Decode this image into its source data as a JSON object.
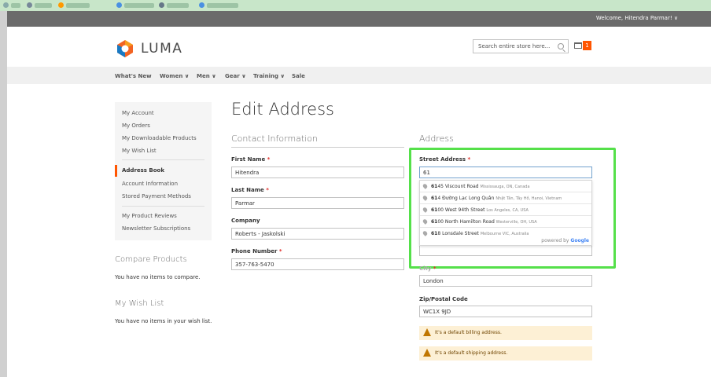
{
  "header": {
    "welcome": "Welcome, Hitendra Parmar! ∨",
    "logo_text": "LUMA",
    "search_placeholder": "Search entire store here...",
    "cart_count": "1"
  },
  "nav": [
    {
      "label": "What's New"
    },
    {
      "label": "Women ∨"
    },
    {
      "label": "Men ∨"
    },
    {
      "label": "Gear ∨"
    },
    {
      "label": "Training ∨"
    },
    {
      "label": "Sale"
    }
  ],
  "sidebar": {
    "items": [
      {
        "label": "My Account"
      },
      {
        "label": "My Orders"
      },
      {
        "label": "My Downloadable Products"
      },
      {
        "label": "My Wish List"
      },
      {
        "label": "Address Book"
      },
      {
        "label": "Account Information"
      },
      {
        "label": "Stored Payment Methods"
      },
      {
        "label": "My Product Reviews"
      },
      {
        "label": "Newsletter Subscriptions"
      }
    ],
    "compare_title": "Compare Products",
    "compare_text": "You have no items to compare.",
    "wishlist_title": "My Wish List",
    "wishlist_text": "You have no items in your wish list."
  },
  "page": {
    "title": "Edit Address",
    "contact_title": "Contact Information",
    "address_title": "Address"
  },
  "form": {
    "first_name_label": "First Name",
    "first_name_value": "Hitendra",
    "last_name_label": "Last Name",
    "last_name_value": "Parmar",
    "company_label": "Company",
    "company_value": "Roberts - Jaskolski",
    "phone_label": "Phone Number",
    "phone_value": "357-763-5470",
    "street_label": "Street Address",
    "street_value": "61",
    "city_label": "City",
    "city_value": "London",
    "zip_label": "Zip/Postal Code",
    "zip_value": "WC1X 9JD",
    "required_mark": "*"
  },
  "autocomplete": {
    "items": [
      {
        "main_bold": "61",
        "main_rest": "45 Viscount Road",
        "sub": "Mississauga, ON, Canada"
      },
      {
        "main_bold": "61",
        "main_rest": "4 Đường Lạc Long Quân",
        "sub": "Nhật Tân, Tây Hồ, Hanoi, Vietnam"
      },
      {
        "main_bold": "61",
        "main_rest": "00 West 94th Street",
        "sub": "Los Angeles, CA, USA"
      },
      {
        "main_bold": "61",
        "main_rest": "00 North Hamilton Road",
        "sub": "Westerville, OH, USA"
      },
      {
        "main_bold": "61",
        "main_rest": "8 Lonsdale Street",
        "sub": "Melbourne VIC, Australia"
      }
    ],
    "powered_by": "powered by",
    "google": "Google"
  },
  "notices": {
    "billing": "It's a default billing address.",
    "shipping": "It's a default shipping address."
  },
  "colors": {
    "accent": "#ff5501",
    "highlight": "#55e04a",
    "notice_bg": "#fdf0d5"
  }
}
